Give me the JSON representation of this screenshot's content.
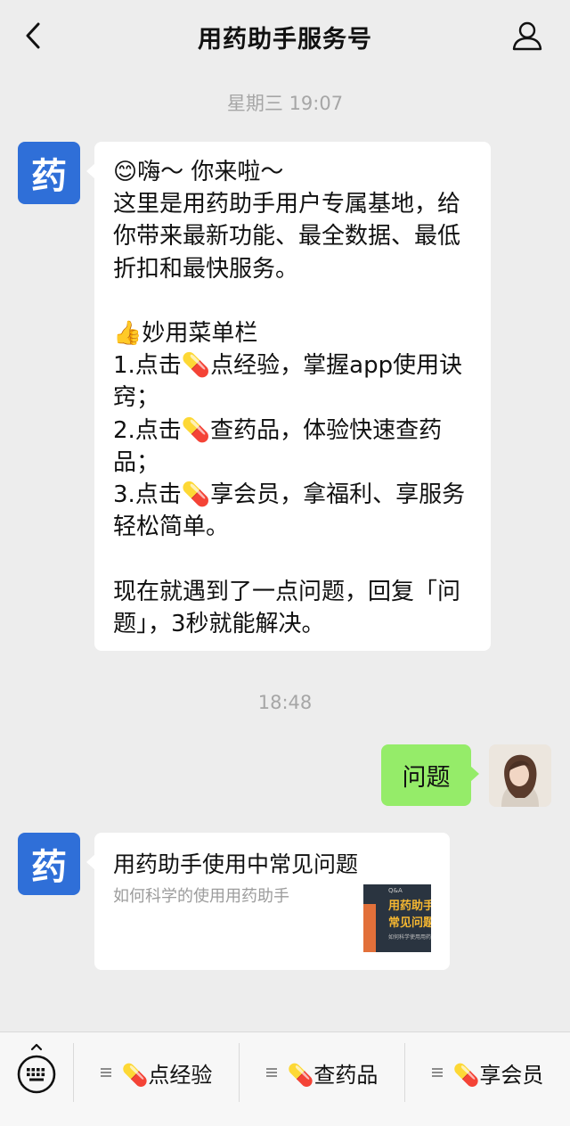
{
  "header": {
    "title": "用药助手服务号",
    "back_icon": "chevron-left-icon",
    "profile_icon": "user-profile-icon"
  },
  "chat": {
    "timestamp_1": "星期三 19:07",
    "bot_avatar_char": "药",
    "welcome_message": "😊嗨～ 你来啦～\n这里是用药助手用户专属基地，给你带来最新功能、最全数据、最低折扣和最快服务。\n\n👍妙用菜单栏\n1.点击💊点经验，掌握app使用诀窍；\n2.点击💊查药品，体验快速查药品；\n3.点击💊享会员，拿福利、享服务轻松简单。\n\n现在就遇到了一点问题，回复「问题」，3秒就能解决。",
    "timestamp_2": "18:48",
    "user_message": "问题",
    "article": {
      "title": "用药助手使用中常见问题",
      "description": "如何科学的使用用药助手",
      "thumb_small": "Q&A",
      "thumb_line1": "用药助手",
      "thumb_line2": "常见问题",
      "thumb_footer": "如何科学使用用药助手"
    }
  },
  "menu": {
    "keyboard_icon": "keyboard-icon",
    "items": [
      {
        "label": "💊点经验",
        "icon": "menu-lines-icon"
      },
      {
        "label": "💊查药品",
        "icon": "menu-lines-icon"
      },
      {
        "label": "💊享会员",
        "icon": "menu-lines-icon"
      }
    ]
  },
  "colors": {
    "background": "#ededed",
    "bot_avatar": "#2f6fd8",
    "user_bubble": "#95ec69",
    "bot_bubble": "#ffffff"
  }
}
